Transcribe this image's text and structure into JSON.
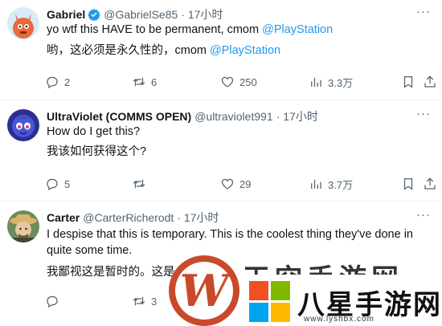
{
  "tweets": [
    {
      "name": "Gabriel",
      "handle": "@GabrielSe85",
      "time": "· 17小时",
      "verified": true,
      "lines": [
        {
          "pre": "yo wtf this HAVE to be permanent, cmom ",
          "mention": "@PlayStation"
        },
        {
          "pre": "哟，这必须是永久性的，cmom ",
          "mention": "@PlayStation"
        }
      ],
      "replies": "2",
      "retweets": "6",
      "likes": "250",
      "views": "3.3万"
    },
    {
      "name": "UltraViolet (COMMS OPEN)",
      "handle": "@ultraviolet991",
      "time": "· 17小时",
      "verified": false,
      "lines": [
        {
          "pre": "How do I get this?",
          "mention": ""
        },
        {
          "pre": "我该如何获得这个?",
          "mention": ""
        }
      ],
      "replies": "5",
      "retweets": "",
      "likes": "29",
      "views": "3.7万"
    },
    {
      "name": "Carter",
      "handle": "@CarterRicherodt",
      "time": "· 17小时",
      "verified": false,
      "lines": [
        {
          "pre": "I despise that this is temporary. This is the coolest thing they've done in",
          "mention": ""
        },
        {
          "pre": "quite some time.",
          "mention": ""
        },
        {
          "pre": "我鄙视这是暂时的。这是",
          "mention": ""
        }
      ],
      "replies": "",
      "retweets": "3",
      "likes": "",
      "views": ""
    }
  ],
  "more_label": "···",
  "watermark": {
    "logo_letter": "W",
    "title": "八星手游网",
    "url": "www.lyshbx.com",
    "top_text": "天空手游网"
  },
  "colors": {
    "accent": "#1d9bf0",
    "muted": "#536471",
    "text": "#0f1419"
  }
}
